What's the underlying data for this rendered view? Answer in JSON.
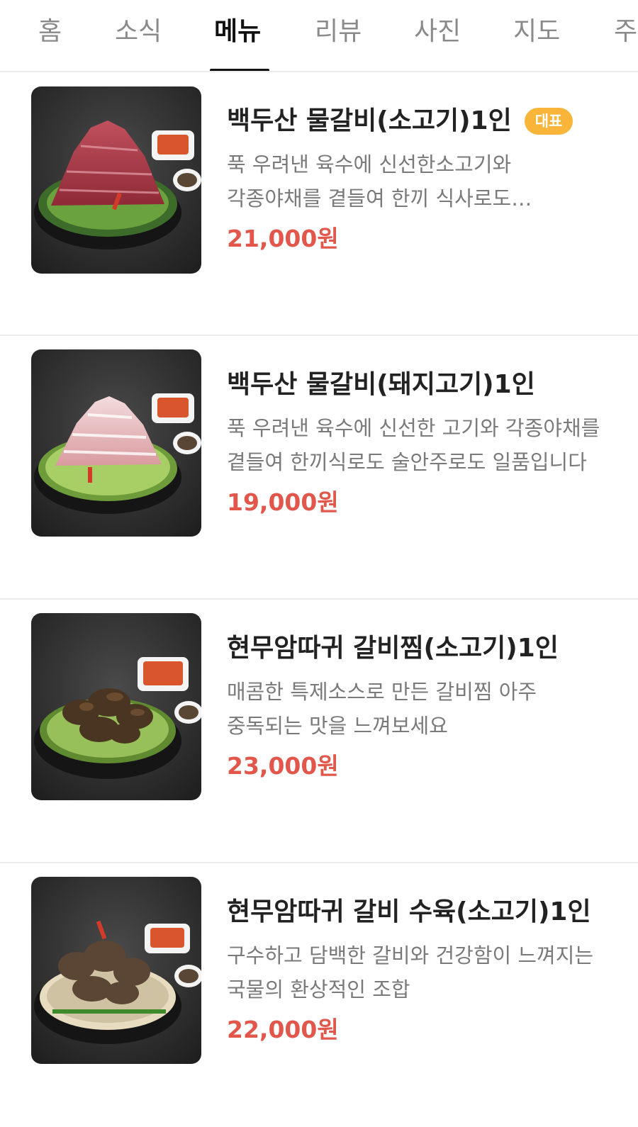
{
  "tabs": [
    {
      "label": "홈",
      "active": false
    },
    {
      "label": "소식",
      "active": false
    },
    {
      "label": "메뉴",
      "active": true
    },
    {
      "label": "리뷰",
      "active": false
    },
    {
      "label": "사진",
      "active": false
    },
    {
      "label": "지도",
      "active": false
    },
    {
      "label": "주",
      "active": false
    }
  ],
  "menu": [
    {
      "name": "백두산 물갈비(소고기)1인",
      "badge": "대표",
      "description": "푹 우려낸 육수에 신선한소고기와 각종야채를 곁들여 한끼 식사로도 술안주로도 일품입니다",
      "price": "21,000원",
      "image": "dish-beef-mountain"
    },
    {
      "name": "백두산 물갈비(돼지고기)1인",
      "description": "푹 우려낸 육수에 신선한 고기와 각종야채를 곁들여 한끼식로도 술안주로도 일품입니다",
      "price": "19,000원",
      "image": "dish-pork-mountain"
    },
    {
      "name": "현무암따귀 갈비찜(소고기)1인",
      "description": "매콤한 특제소스로 만든 갈비찜 아주 중독되는 맛을 느껴보세요",
      "price": "23,000원",
      "image": "dish-braised-ribs"
    },
    {
      "name": "현무암따귀 갈비 수육(소고기)1인",
      "description": "구수하고 담백한 갈비와 건강함이 느껴지는 국물의 환상적인 조합",
      "price": "22,000원",
      "image": "dish-boiled-ribs"
    }
  ],
  "colors": {
    "price": "#e2574c",
    "badge": "#f9b53a",
    "active_tab": "#111111",
    "inactive_tab": "#8a8a8a"
  }
}
